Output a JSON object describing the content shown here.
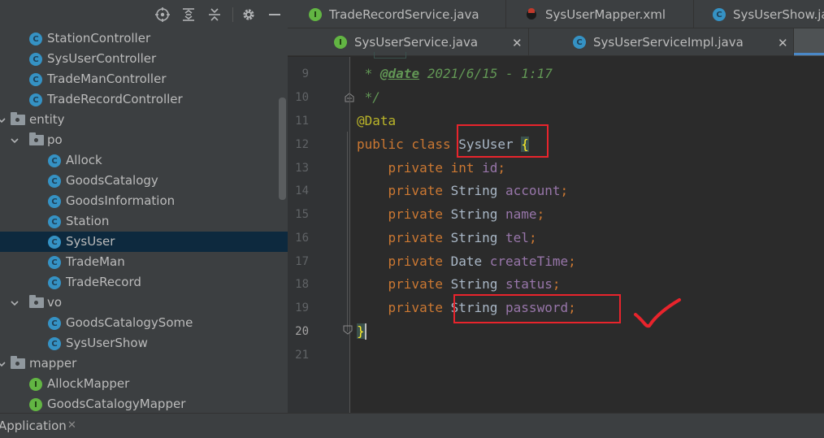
{
  "project_panel": {
    "tree": [
      {
        "label": "StationController",
        "kind": "class",
        "depth": 1
      },
      {
        "label": "SysUserController",
        "kind": "class",
        "depth": 1
      },
      {
        "label": "TradeManController",
        "kind": "class",
        "depth": 1
      },
      {
        "label": "TradeRecordController",
        "kind": "class",
        "depth": 1
      },
      {
        "label": "entity",
        "kind": "package",
        "depth": 0
      },
      {
        "label": "po",
        "kind": "package",
        "depth": 1
      },
      {
        "label": "Allock",
        "kind": "class",
        "depth": 2
      },
      {
        "label": "GoodsCatalogy",
        "kind": "class",
        "depth": 2
      },
      {
        "label": "GoodsInformation",
        "kind": "class",
        "depth": 2
      },
      {
        "label": "Station",
        "kind": "class",
        "depth": 2
      },
      {
        "label": "SysUser",
        "kind": "class",
        "depth": 2,
        "selected": true
      },
      {
        "label": "TradeMan",
        "kind": "class",
        "depth": 2
      },
      {
        "label": "TradeRecord",
        "kind": "class",
        "depth": 2
      },
      {
        "label": "vo",
        "kind": "package",
        "depth": 1
      },
      {
        "label": "GoodsCatalogySome",
        "kind": "class",
        "depth": 2
      },
      {
        "label": "SysUserShow",
        "kind": "class",
        "depth": 2
      },
      {
        "label": "mapper",
        "kind": "package",
        "depth": 0
      },
      {
        "label": "AllockMapper",
        "kind": "interface",
        "depth": 1
      },
      {
        "label": "GoodsCatalogyMapper",
        "kind": "interface",
        "depth": 1
      }
    ],
    "class_icon_letter": "C",
    "interface_icon_letter": "I"
  },
  "tabs": {
    "row1": [
      {
        "label": "TradeRecordService.java",
        "icon": "interface-icon"
      },
      {
        "label": "SysUserMapper.xml",
        "icon": "xml-icon"
      },
      {
        "label": "SysUserShow.ja",
        "icon": "class-icon"
      }
    ],
    "row2": [
      {
        "label": "SysUserService.java",
        "icon": "interface-icon"
      },
      {
        "label": "SysUserServiceImpl.java",
        "icon": "class-icon"
      }
    ],
    "close_glyph": "✕"
  },
  "editor": {
    "line_numbers": [
      "9",
      "10",
      "11",
      "12",
      "13",
      "14",
      "15",
      "16",
      "17",
      "18",
      "19",
      "20",
      "21"
    ],
    "current_line": "20",
    "code": {
      "l9_star": " * ",
      "l9_tag": "@date",
      "l9_text": " 2021/6/15 - 1:17",
      "l10": " */",
      "l11": "@Data",
      "l12_kw": "public class ",
      "l12_name": "SysUser ",
      "l12_brace": "{",
      "l13_kw": "    private int ",
      "l13_field": "id",
      "l14_kw": "    private ",
      "l14_type": "String ",
      "l14_field": "account",
      "l15_kw": "    private ",
      "l15_type": "String ",
      "l15_field": "name",
      "l16_kw": "    private ",
      "l16_type": "String ",
      "l16_field": "tel",
      "l17_kw": "    private ",
      "l17_type": "Date ",
      "l17_field": "createTime",
      "l18_kw": "    private ",
      "l18_type": "String ",
      "l18_field": "status",
      "l19_kw": "    private ",
      "l19_type": "String ",
      "l19_field": "password",
      "semicolon": ";",
      "l20": "}"
    }
  },
  "bottom_bar": {
    "run_tab_label": "Application",
    "close_glyph": "✕"
  },
  "colors": {
    "keyword": "#cc7832",
    "annotation": "#bbb529",
    "field": "#9876aa",
    "comment": "#629755",
    "highlight_box": "#e8242c"
  }
}
